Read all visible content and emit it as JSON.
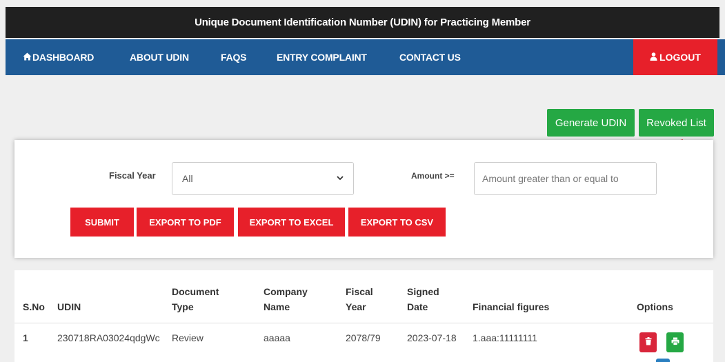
{
  "header": {
    "title": "Unique Document Identification Number (UDIN) for Practicing Member"
  },
  "nav": {
    "items": [
      {
        "label": "DASHBOARD",
        "icon": "home-icon"
      },
      {
        "label": "ABOUT UDIN"
      },
      {
        "label": "FAQS"
      },
      {
        "label": "ENTRY COMPLAINT"
      },
      {
        "label": "CONTACT US"
      }
    ],
    "logout": {
      "label": "LOGOUT",
      "icon": "user-icon"
    }
  },
  "actions": {
    "generate": "Generate UDIN",
    "revoked": "Revoked List"
  },
  "filters": {
    "fiscal_year_label": "Fiscal Year",
    "fiscal_year_value": "All",
    "amount_label": "Amount >=",
    "amount_placeholder": "Amount greater than or equal to",
    "buttons": {
      "submit": "SUBMIT",
      "pdf": "EXPORT TO PDF",
      "excel": "EXPORT TO EXCEL",
      "csv": "EXPORT TO CSV"
    }
  },
  "table": {
    "headers": {
      "sno": "S.No",
      "udin": "UDIN",
      "doc_type_1": "Document",
      "doc_type_2": "Type",
      "company_1": "Company",
      "company_2": "Name",
      "fiscal_1": "Fiscal",
      "fiscal_2": "Year",
      "signed_1": "Signed",
      "signed_2": "Date",
      "financial": "Financial figures",
      "options": "Options"
    },
    "rows": [
      {
        "sno": "1",
        "udin": "230718RA03024qdgWc",
        "doc_type": "Review",
        "company": "aaaaa",
        "fiscal_year": "2078/79",
        "signed_date": "2023-07-18",
        "financial": "1.aaa:11111111"
      }
    ]
  },
  "colors": {
    "nav_bg": "#1f5b96",
    "title_bg": "#202020",
    "red": "#e7202a",
    "green": "#25a844"
  }
}
